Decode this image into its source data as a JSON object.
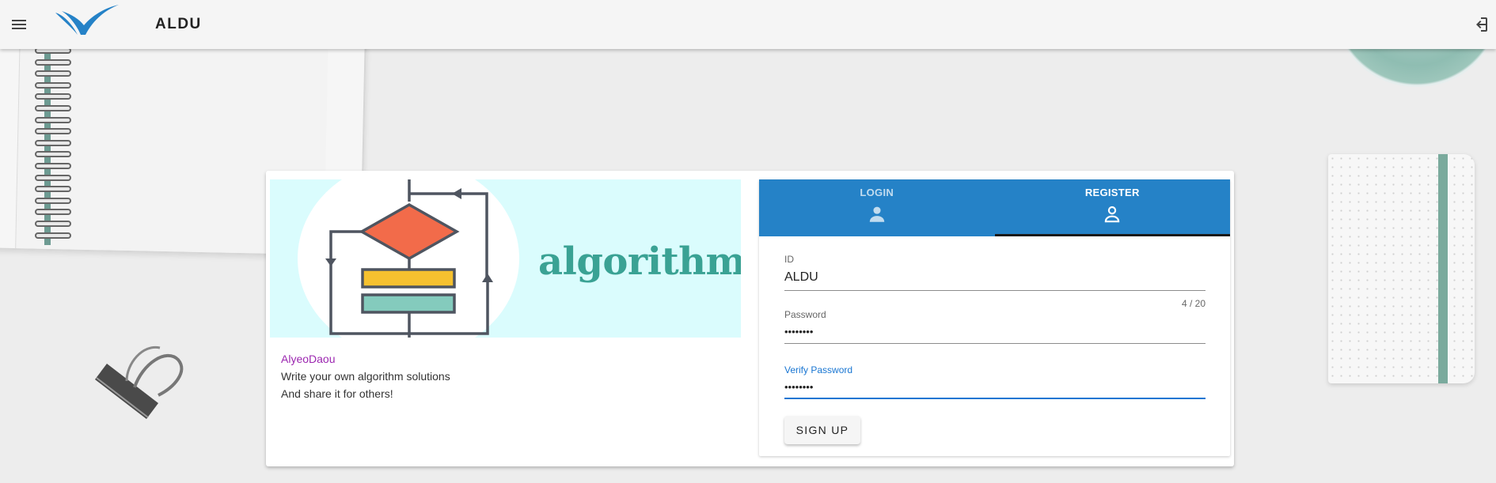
{
  "appbar": {
    "title": "ALDU",
    "menu_icon": "hamburger-menu-icon",
    "logo_icon": "bird-wing-logo",
    "login_icon": "login-enter-icon",
    "background_color": "#f5f5f5"
  },
  "banner": {
    "word": "algorithm",
    "background_color": "#dafcfd",
    "word_color": "#3aa294",
    "diamond_color": "#f26b4a",
    "bar1_color": "#f6c12f",
    "bar2_color": "#84cbbd"
  },
  "info": {
    "author": "AlyeoDaou",
    "line1": "Write your own algorithm solutions",
    "line2": "And share it for others!"
  },
  "auth": {
    "tabs": [
      {
        "label": "LOGIN",
        "icon": "person-filled-icon",
        "active": false
      },
      {
        "label": "REGISTER",
        "icon": "person-outline-icon",
        "active": true
      }
    ],
    "tab_color": "#2582c7",
    "id": {
      "label": "ID",
      "value": "ALDU",
      "counter": "4 / 20"
    },
    "password": {
      "label": "Password",
      "value": "••••••••"
    },
    "verify_password": {
      "label": "Verify Password",
      "value": "••••••••"
    },
    "signup_label": "SIGN UP"
  },
  "accent_color": "#1976d2",
  "author_color": "#9c27b0"
}
